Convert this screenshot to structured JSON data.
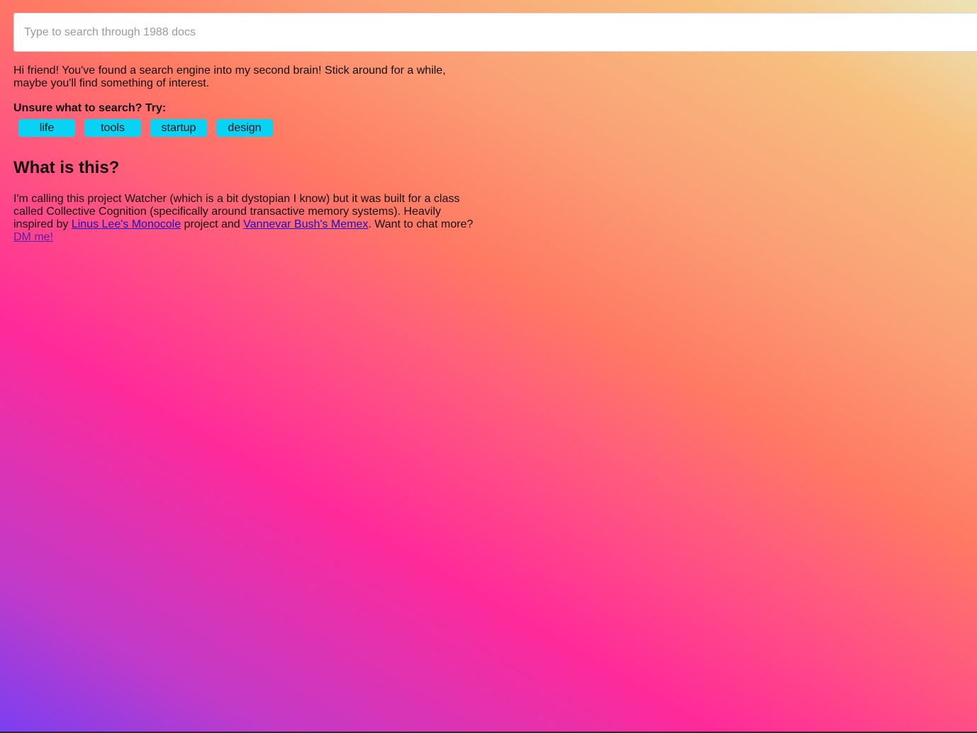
{
  "search": {
    "placeholder": "Type to search through 1988 docs",
    "value": ""
  },
  "intro": {
    "text": "Hi friend! You've found a search engine into my second brain! Stick around for a while, maybe you'll find something of interest."
  },
  "suggestions": {
    "label": "Unsure what to search? Try:",
    "chips": [
      "life",
      "tools",
      "startup",
      "design"
    ]
  },
  "about": {
    "heading": "What is this?",
    "text_part1": "I'm calling this project Watcher (which is a bit dystopian I know) but it was built for a class called Collective Cognition (specifically around transactive memory systems). Heavily inspired by ",
    "link1": "Linus Lee's Monocole",
    "text_part2": " project and ",
    "link2": "Vannevar Bush's Memex",
    "text_part3": ". Want to chat more? ",
    "link3": "DM me!"
  },
  "colors": {
    "chip_bg": "#08d3f5",
    "link": "#1a0dcc",
    "link_visited": "#5a1fa8",
    "gradient": [
      "#7b3ff2",
      "#ff2a9a",
      "#ff7a63",
      "#f7c07f",
      "#ece3b8"
    ]
  }
}
